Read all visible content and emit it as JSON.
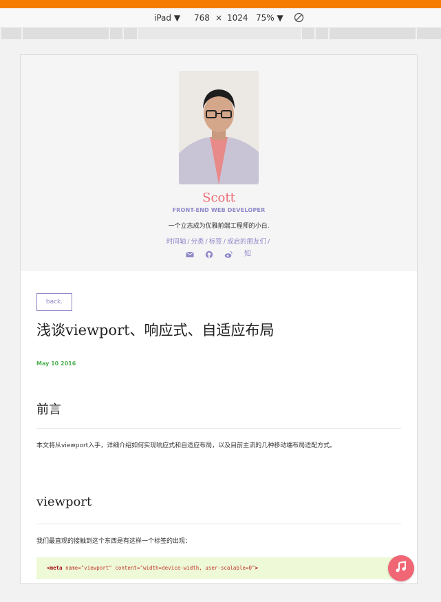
{
  "devtools": {
    "device": "iPad ▼",
    "width": "768",
    "times": "×",
    "height": "1024",
    "zoom": "75% ▼"
  },
  "profile": {
    "name": "Scott",
    "subtitle": "FRONT-END WEB DEVELOPER",
    "motto": "一个立志成为优雅前端工程师的小白."
  },
  "nav": {
    "items": [
      "时间轴",
      "分类",
      "标签",
      "成启的朋友们"
    ],
    "separator": "/"
  },
  "social_icons": [
    "mail-icon",
    "github-icon",
    "weibo-icon",
    "zhihu-icon"
  ],
  "social_zhihu_glyph": "知",
  "post": {
    "back_label": "back.",
    "title": "浅谈viewport、响应式、自适应布局",
    "date": "May 10 2016",
    "section1_heading": "前言",
    "section1_text": "本文将从viewport入手，详细介绍如何实现响应式和自适应布局，以及目前主流的几种移动端布局适配方式。",
    "section2_heading": "viewport",
    "section2_text": "我们最直观的接触到这个东西是有这样一个标签的出现：",
    "code": {
      "open": "<meta",
      "attr1": "name=",
      "val1": "\"viewport\"",
      "attr2": "content=",
      "val2": "\"width=device-width, user-scalable=0\"",
      "close": ">"
    }
  },
  "colors": {
    "accent": "#8e88c9",
    "name": "#ef6b73",
    "date": "#4caf50",
    "music": "#f06674",
    "topbar": "#f57c00",
    "code_bg": "#eef9d8"
  }
}
